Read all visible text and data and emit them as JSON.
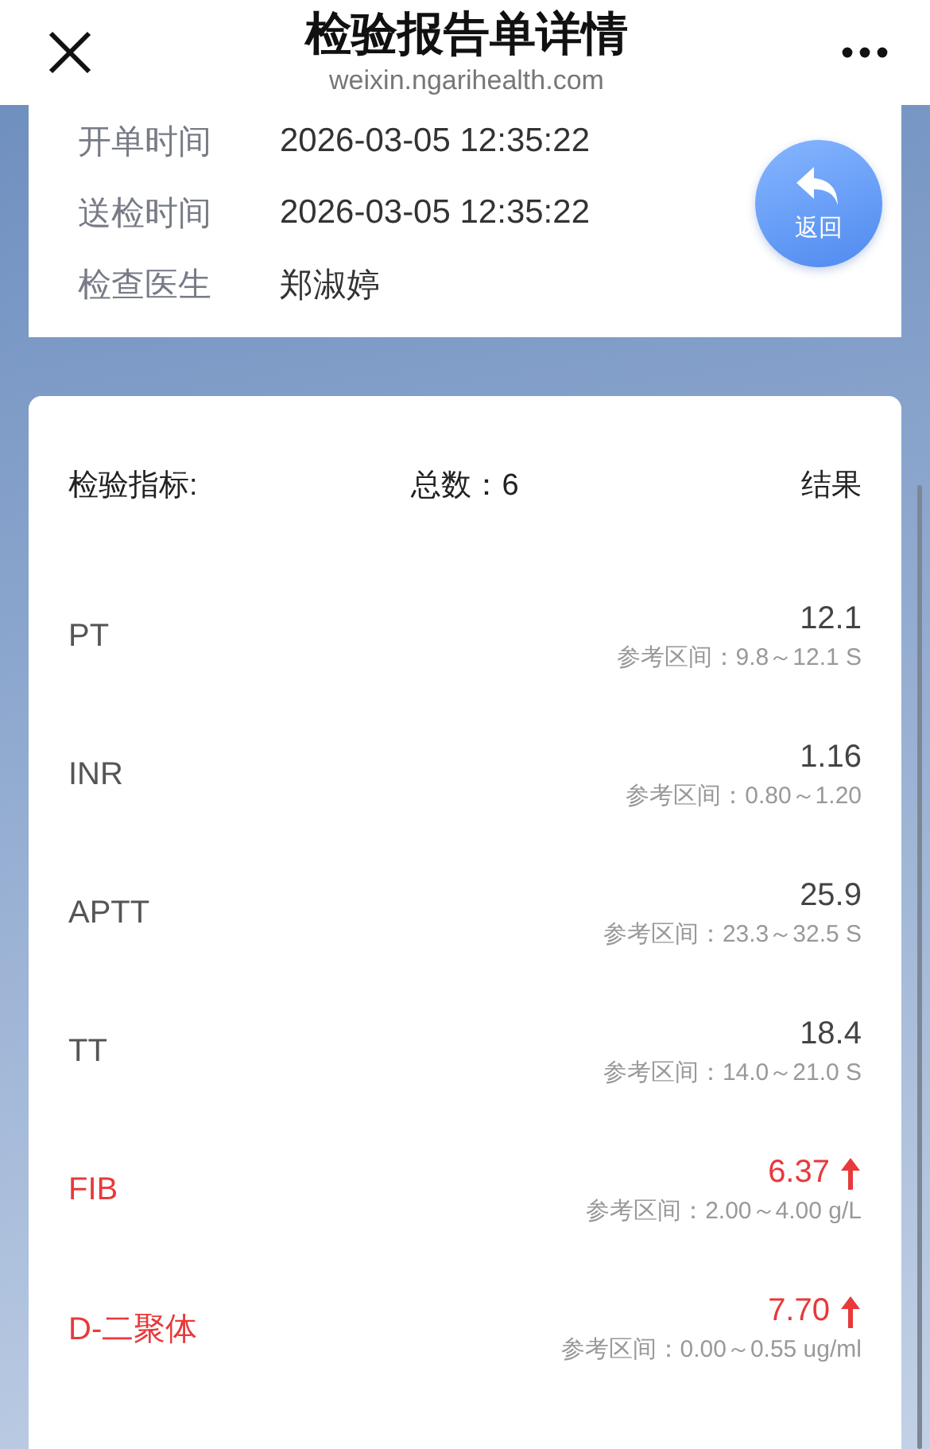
{
  "header": {
    "title": "检验报告单详情",
    "subtitle": "weixin.ngarihealth.com"
  },
  "info": [
    {
      "label": "开单时间",
      "value": "2026-03-05 12:35:22"
    },
    {
      "label": "送检时间",
      "value": "2026-03-05 12:35:22"
    },
    {
      "label": "检查医生",
      "value": "郑淑婷"
    }
  ],
  "back_button": {
    "label": "返回"
  },
  "results": {
    "heading": "检验指标:",
    "total": "总数：6",
    "result_heading": "结果",
    "rows": [
      {
        "name": "PT",
        "value": "12.1",
        "reference": "参考区间：9.8～12.1 S",
        "high": false
      },
      {
        "name": "INR",
        "value": "1.16",
        "reference": "参考区间：0.80～1.20",
        "high": false
      },
      {
        "name": "APTT",
        "value": "25.9",
        "reference": "参考区间：23.3～32.5 S",
        "high": false
      },
      {
        "name": "TT",
        "value": "18.4",
        "reference": "参考区间：14.0～21.0 S",
        "high": false
      },
      {
        "name": "FIB",
        "value": "6.37",
        "reference": "参考区间：2.00～4.00 g/L",
        "high": true
      },
      {
        "name": "D-二聚体",
        "value": "7.70",
        "reference": "参考区间：0.00～0.55 ug/ml",
        "high": true
      }
    ]
  }
}
